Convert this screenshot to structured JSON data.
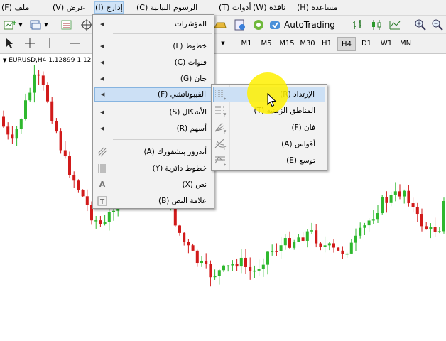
{
  "menubar": {
    "items": [
      {
        "label": "ملف (F)",
        "active": false
      },
      {
        "label": "عرض (V)",
        "active": false
      },
      {
        "label": "إدارج (I)",
        "active": true
      },
      {
        "label": "الرسوم البيانية (C)",
        "active": false
      },
      {
        "label": "أدوات (T)",
        "active": false
      },
      {
        "label": "نافذة (W)",
        "active": false
      },
      {
        "label": "مساعدة (H)",
        "active": false
      }
    ]
  },
  "toolbar": {
    "autotrading_label": "AutoTrading",
    "timeframes": [
      {
        "label": "M1",
        "selected": false
      },
      {
        "label": "M5",
        "selected": false
      },
      {
        "label": "M15",
        "selected": false
      },
      {
        "label": "M30",
        "selected": false
      },
      {
        "label": "H1",
        "selected": false
      },
      {
        "label": "H4",
        "selected": true
      },
      {
        "label": "D1",
        "selected": false
      },
      {
        "label": "W1",
        "selected": false
      },
      {
        "label": "MN",
        "selected": false
      }
    ]
  },
  "chart": {
    "symbol_label": "EURUSD,H4  1.12899 1.12"
  },
  "insert_menu": {
    "items": [
      {
        "label": "المؤشرات",
        "submenu": true
      },
      {
        "label": "خطوط (L)",
        "submenu": true
      },
      {
        "label": "قنوات (C)",
        "submenu": true
      },
      {
        "label": "جان (G)",
        "submenu": true
      },
      {
        "label": "الفيبوناتشي (F)",
        "submenu": true,
        "highlighted": true
      },
      {
        "label": "الأشكال (S)",
        "submenu": true
      },
      {
        "label": "أسهم (R)",
        "submenu": true
      },
      {
        "label": "أندروز بتشفورك (A)",
        "icon": "pitchfork-icon"
      },
      {
        "label": "خطوط دائرية (Y)",
        "icon": "cycle-lines-icon"
      },
      {
        "label": "نص (X)",
        "icon": "text-icon"
      },
      {
        "label": "علامة النص (B)",
        "icon": "text-label-icon"
      }
    ]
  },
  "fibonacci_menu": {
    "items": [
      {
        "label": "الإرتداد (R)",
        "highlighted": true,
        "icon": "fibo-retracement-icon"
      },
      {
        "label": "المناطق الزمنية (T)",
        "icon": "fibo-timezones-icon"
      },
      {
        "label": "فان (F)",
        "icon": "fibo-fan-icon"
      },
      {
        "label": "أقواس (A)",
        "icon": "fibo-arcs-icon"
      },
      {
        "label": "توسع (E)",
        "icon": "fibo-expansion-icon"
      }
    ]
  },
  "colors": {
    "bull_candle": "#2eb82e",
    "bear_candle": "#d11a1a",
    "menu_highlight": "#cce0f5",
    "cursor_highlight": "#fff000"
  }
}
